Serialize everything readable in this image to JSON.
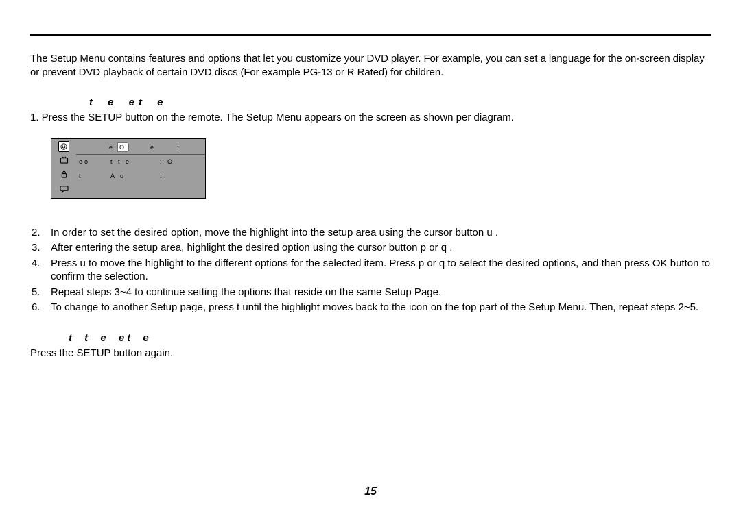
{
  "intro": "The Setup Menu contains features and options that let you customize your DVD player. For example, you can set a language for the on-screen display or prevent DVD playback of certain DVD discs (For example PG-13 or R Rated) for children.",
  "heading_use": "t e et e",
  "step1": "1.  Press the SETUP button on the remote. The Setup Menu appears on the screen as shown per diagram.",
  "diagram": {
    "header": {
      "c1a": "e",
      "c1b": "O",
      "c2": "e",
      "c3": ":"
    },
    "rows": [
      {
        "label": "eo",
        "c2": "t t e",
        "c3": ": O"
      },
      {
        "label": "t",
        "c2": "A   o",
        "c3": ":"
      }
    ]
  },
  "steps": [
    {
      "n": "2.",
      "t": "In order to set the desired option, move the highlight into the setup area using the cursor button  u ."
    },
    {
      "n": "3.",
      "t": "After entering the setup area, highlight the desired option using the cursor button  p  or  q ."
    },
    {
      "n": "4.",
      "t": "Press  u  to move the highlight to the different options for the selected item. Press  p  or  q  to select the desired options, and then press OK button to confirm the selection."
    },
    {
      "n": "5.",
      "t": "Repeat steps 3~4 to continue setting the options that reside on the same Setup Page."
    },
    {
      "n": "6.",
      "t": "To change to another Setup page, press  t  until the highlight moves back to the icon on the top part of the Setup Menu. Then, repeat steps 2~5."
    }
  ],
  "heading_exit": "t t e et e",
  "exit_text": "Press the SETUP button again.",
  "page_number": "15"
}
